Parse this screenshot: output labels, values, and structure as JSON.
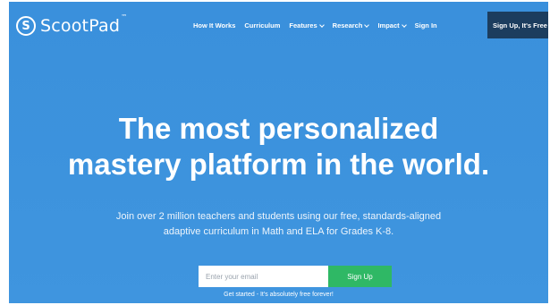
{
  "brand": {
    "name": "ScootPad",
    "trademark": "™",
    "logo_letter": "S",
    "logo_icon": "scootpad-logo-icon"
  },
  "nav": {
    "items": [
      {
        "label": "How It Works",
        "has_dropdown": false
      },
      {
        "label": "Curriculum",
        "has_dropdown": false
      },
      {
        "label": "Features",
        "has_dropdown": true
      },
      {
        "label": "Research",
        "has_dropdown": true
      },
      {
        "label": "Impact",
        "has_dropdown": true
      },
      {
        "label": "Sign In",
        "has_dropdown": false
      }
    ],
    "signup_label": "Sign Up, It's Free"
  },
  "hero": {
    "headline_line1": "The most personalized",
    "headline_line2": "mastery platform in the world.",
    "subtext_line1": "Join over 2 million teachers and students using our free, standards-aligned",
    "subtext_line2": "adaptive curriculum in Math and ELA for Grades K-8.",
    "email_placeholder": "Enter your email",
    "submit_label": "Sign Up",
    "tagline": "Get started - It's absolutely free forever!"
  },
  "colors": {
    "hero_background": "#3d93dd",
    "signup_nav_button": "#1c3d5e",
    "submit_button": "#2fb865",
    "text": "#ffffff"
  }
}
